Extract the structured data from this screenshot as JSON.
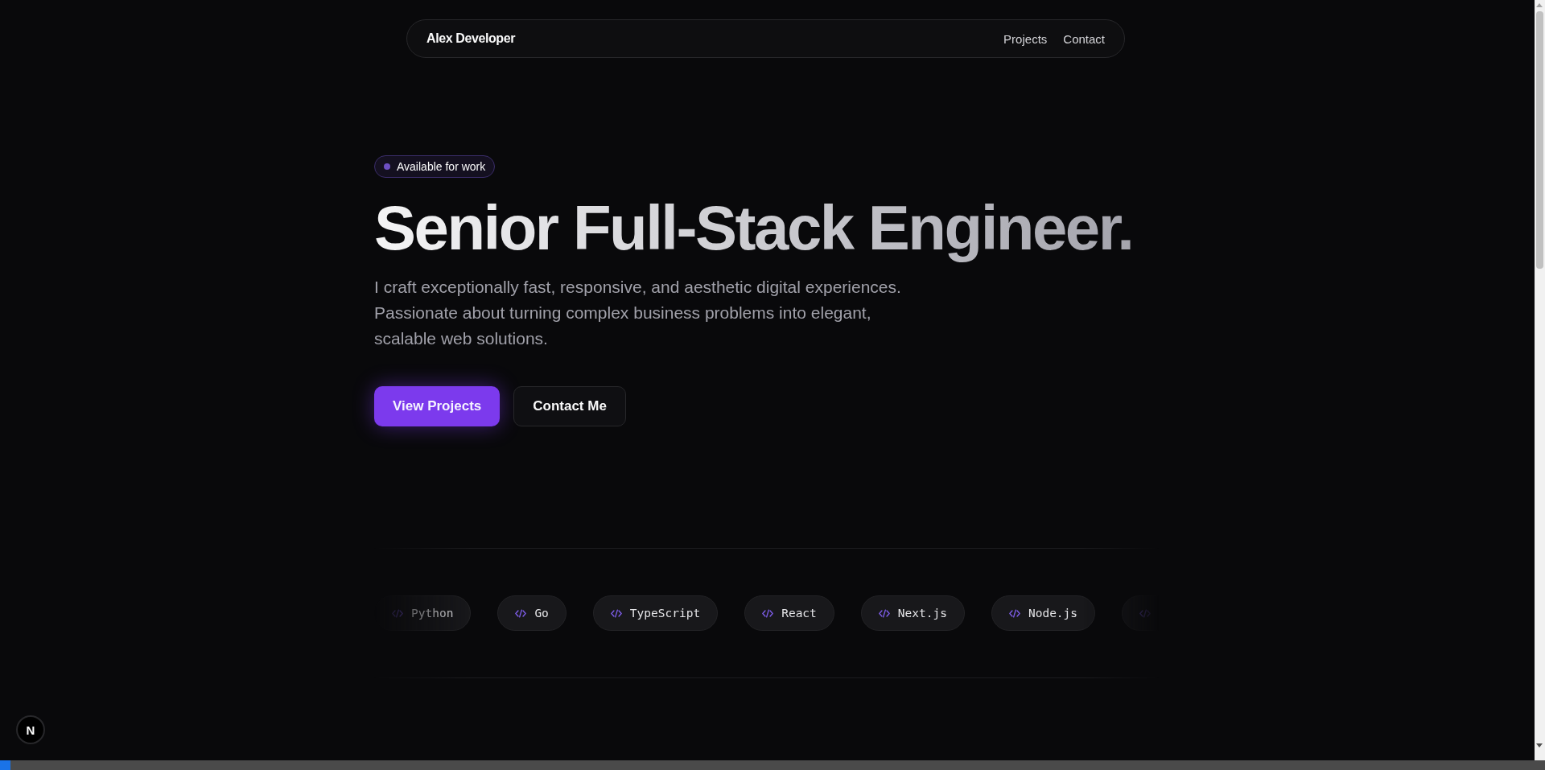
{
  "nav": {
    "brand": "Alex Developer",
    "links": [
      "Projects",
      "Contact"
    ]
  },
  "hero": {
    "badge": {
      "label": "Available for work",
      "color": "#6d4fc2"
    },
    "title": "Senior Full-Stack Engineer.",
    "lines": [
      "I craft exceptionally fast, responsive, and aesthetic digital experiences.",
      "Passionate about turning complex business problems into elegant,",
      "scalable web solutions."
    ],
    "buttons": [
      {
        "label": "View Projects",
        "kind": "primary"
      },
      {
        "label": "Contact Me",
        "kind": "secondary"
      }
    ]
  },
  "tech": [
    "Python",
    "Go",
    "TypeScript",
    "React",
    "Next.js",
    "Node.js"
  ],
  "dev_indicator": "N"
}
